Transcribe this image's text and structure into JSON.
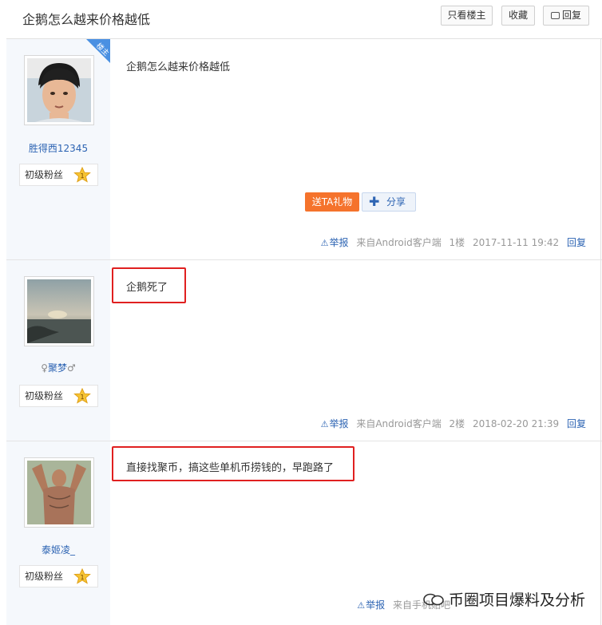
{
  "thread": {
    "title": "企鹅怎么越来价格越低",
    "only_op_label": "只看楼主",
    "favorite_label": "收藏",
    "reply_label": "回复"
  },
  "posts": [
    {
      "username": "胜得西12345",
      "badge": "初级粉丝",
      "level": "1",
      "op_tag": "楼主",
      "content": "企鹅怎么越来价格越低",
      "gift_label": "送TA礼物",
      "share_label": "分享",
      "report": "举报",
      "source": "来自Android客户端",
      "floor": "1楼",
      "time": "2017-11-11 19:42",
      "reply": "回复"
    },
    {
      "username": "聚梦",
      "badge": "初级粉丝",
      "level": "1",
      "content": "企鹅死了",
      "report": "举报",
      "source": "来自Android客户端",
      "floor": "2楼",
      "time": "2018-02-20 21:39",
      "reply": "回复"
    },
    {
      "username": "泰姬凌_",
      "badge": "初级粉丝",
      "level": "1",
      "content": "直接找聚币，搞这些单机币捞钱的，早跑路了",
      "report": "举报",
      "source": "来自手机贴吧"
    }
  ],
  "watermark": "币圈项目爆料及分析",
  "colors": {
    "link": "#2d64b3",
    "gift": "#f5732c",
    "highlight_box": "#e02020",
    "sidebar": "#f5f8fc"
  }
}
